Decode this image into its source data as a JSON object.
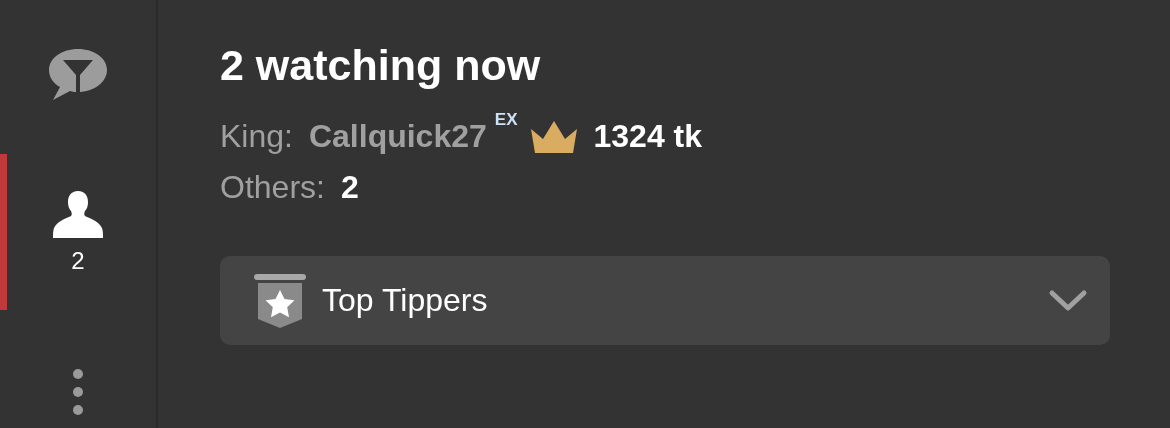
{
  "sidebar": {
    "items": [
      {
        "kind": "chat",
        "selected": false
      },
      {
        "kind": "users",
        "selected": true,
        "count": "2"
      },
      {
        "kind": "more",
        "selected": false
      }
    ]
  },
  "heading": "2 watching now",
  "king": {
    "label": "King:",
    "name": "Callquick27",
    "badge": "EX",
    "tokens": "1324 tk"
  },
  "others": {
    "label": "Others:",
    "value": "2"
  },
  "dropdown": {
    "label": "Top Tippers",
    "expanded": false
  }
}
